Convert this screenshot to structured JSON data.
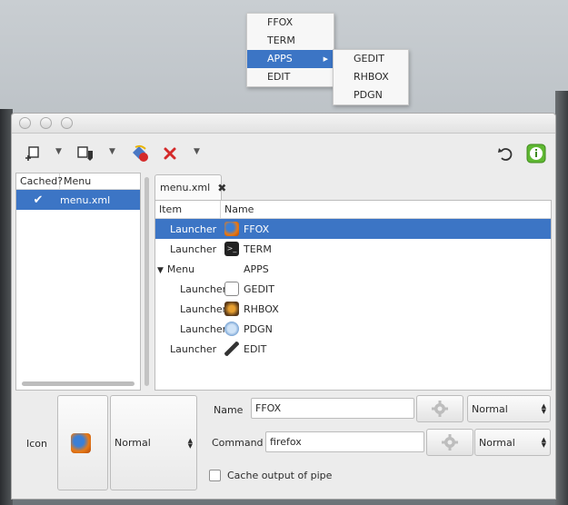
{
  "main_menu": {
    "items": [
      {
        "label": "FFOX"
      },
      {
        "label": "TERM"
      },
      {
        "label": "APPS"
      },
      {
        "label": "EDIT"
      }
    ]
  },
  "sub_menu": {
    "items": [
      {
        "label": "GEDIT"
      },
      {
        "label": "RHBOX"
      },
      {
        "label": "PDGN"
      }
    ]
  },
  "left_pane": {
    "col_cached": "Cached?",
    "col_menu": "Menu",
    "rows": [
      {
        "cached": "✔",
        "menu": "menu.xml"
      }
    ]
  },
  "tab": {
    "label": "menu.xml",
    "close_glyph": "✖"
  },
  "tree": {
    "col_item": "Item",
    "col_name": "Name",
    "expander": "▼",
    "rows": [
      {
        "item": "Launcher",
        "name": "FFOX",
        "icon": "firefox-icon"
      },
      {
        "item": "Launcher",
        "name": "TERM",
        "icon": "terminal-icon"
      },
      {
        "item": "Menu",
        "name": "APPS",
        "icon": ""
      },
      {
        "item": "Launcher",
        "name": "GEDIT",
        "icon": "gedit-icon"
      },
      {
        "item": "Launcher",
        "name": "RHBOX",
        "icon": "rhbox-icon"
      },
      {
        "item": "Launcher",
        "name": "PDGN",
        "icon": "pidgin-icon"
      },
      {
        "item": "Launcher",
        "name": "EDIT",
        "icon": "edit-icon"
      }
    ]
  },
  "form": {
    "icon_label": "Icon",
    "icon_mode": "Normal",
    "name_label": "Name",
    "name_value": "FFOX",
    "name_mode": "Normal",
    "command_label": "Command",
    "command_value": "firefox",
    "command_mode": "Normal",
    "cache_label": "Cache output of pipe"
  },
  "colors": {
    "selection": "#3c75c5",
    "info_green": "#5fb832",
    "delete_red": "#d42a2a"
  }
}
